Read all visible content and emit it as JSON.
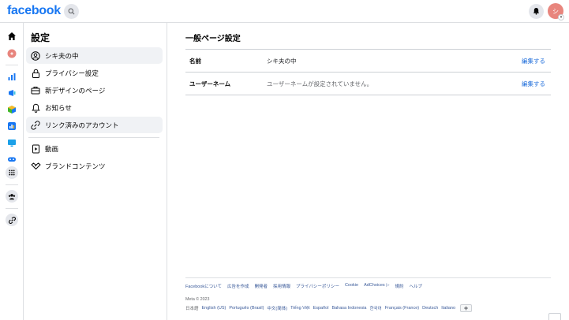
{
  "header": {
    "logo": "facebook",
    "avatar_text": "シ",
    "icons": {
      "search": "search-icon",
      "bell": "bell-icon",
      "caret": "chevron-down-icon"
    }
  },
  "rail": {
    "icons": [
      "home-icon",
      "profile-icon",
      "insights-icon",
      "ads-icon",
      "meta-business-icon",
      "analytics-icon",
      "monitor-icon",
      "game-controller-icon",
      "all-tools-grid-icon",
      "groups-icon",
      "link-icon"
    ]
  },
  "settings_nav": {
    "title": "設定",
    "items": [
      {
        "label": "シキ夫の中",
        "icon": "user-circle-icon",
        "active": true
      },
      {
        "label": "プライバシー設定",
        "icon": "lock-icon",
        "active": false
      },
      {
        "label": "新デザインのページ",
        "icon": "briefcase-icon",
        "active": false
      },
      {
        "label": "お知らせ",
        "icon": "bell-outline-icon",
        "active": false
      },
      {
        "label": "リンク済みのアカウント",
        "icon": "link-icon",
        "active": true
      },
      {
        "label": "動画",
        "icon": "video-icon",
        "active": false
      },
      {
        "label": "ブランドコンテンツ",
        "icon": "handshake-icon",
        "active": false
      }
    ]
  },
  "main": {
    "title": "一般ページ設定",
    "rows": [
      {
        "label": "名前",
        "value": "シキ夫の中",
        "edit": "編集する"
      },
      {
        "label": "ユーザーネーム",
        "value": "ユーザーネームが設定されていません。",
        "edit": "編集する"
      }
    ]
  },
  "footer": {
    "links": [
      "Facebookについて",
      "広告を作成",
      "開発者",
      "採用情報",
      "プライバシーポリシー",
      "Cookie",
      "AdChoices",
      "規約",
      "ヘルプ"
    ],
    "copyright": "Meta © 2023",
    "current_language": "日本語",
    "languages": [
      "English (US)",
      "Português (Brasil)",
      "中文(简体)",
      "Tiếng Việt",
      "Español",
      "Bahasa Indonesia",
      "한국어",
      "Français (France)",
      "Deutsch",
      "Italiano"
    ],
    "add_language": "+"
  },
  "colors": {
    "brand": "#1877f2",
    "link": "#216fdb",
    "avatar": "#e8857d"
  }
}
